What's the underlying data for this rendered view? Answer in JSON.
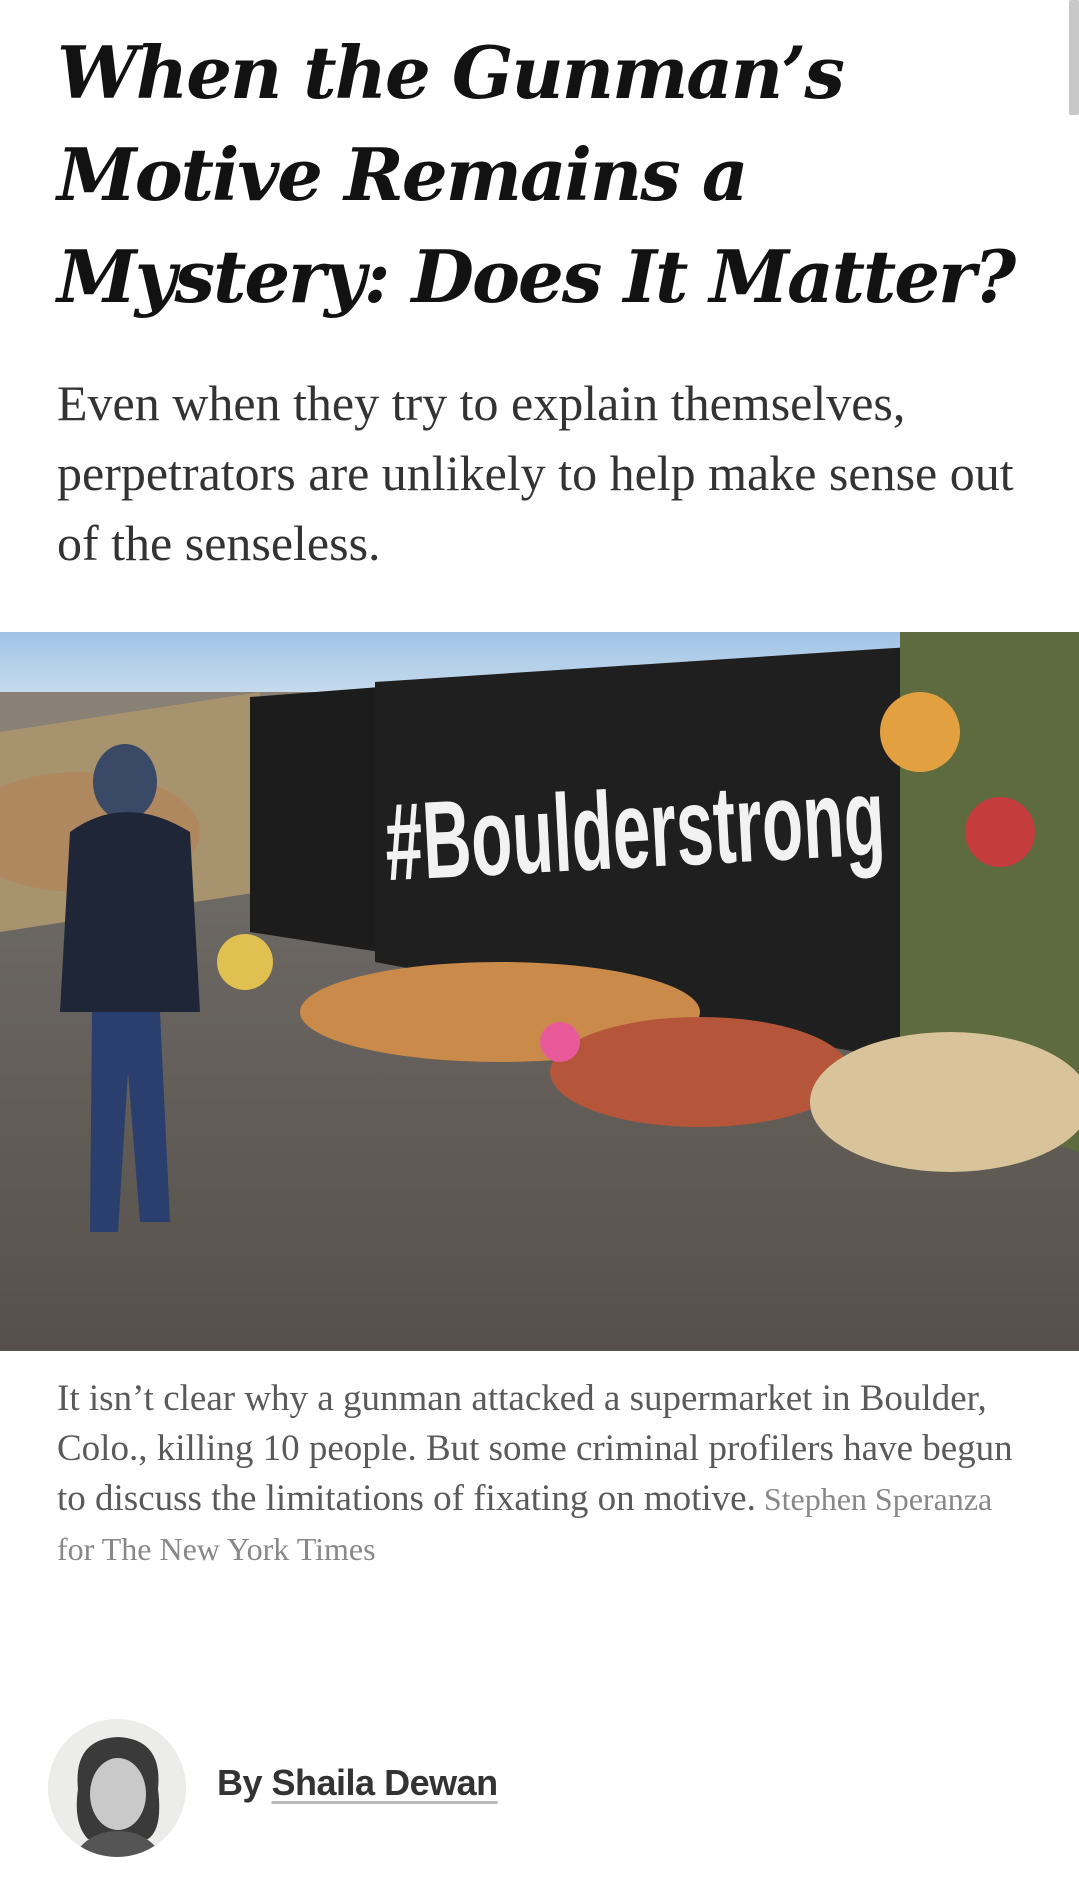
{
  "article": {
    "headline": "When the Gunman’s Motive Remains a Mystery: Does It Matter?",
    "summary": "Even when they try to explain themselves, perpetrators are unlikely to help make sense out of the senseless.",
    "image": {
      "banner_text": "#Boulderstrong",
      "caption": "It isn’t clear why a gunman attacked a supermarket in Boulder, Colo., killing 10 people. But some criminal profilers have begun to discuss the limitations of fixating on motive.",
      "credit": "Stephen Speranza for The New York Times"
    },
    "byline": {
      "prefix": "By ",
      "author": "Shaila Dewan"
    }
  }
}
